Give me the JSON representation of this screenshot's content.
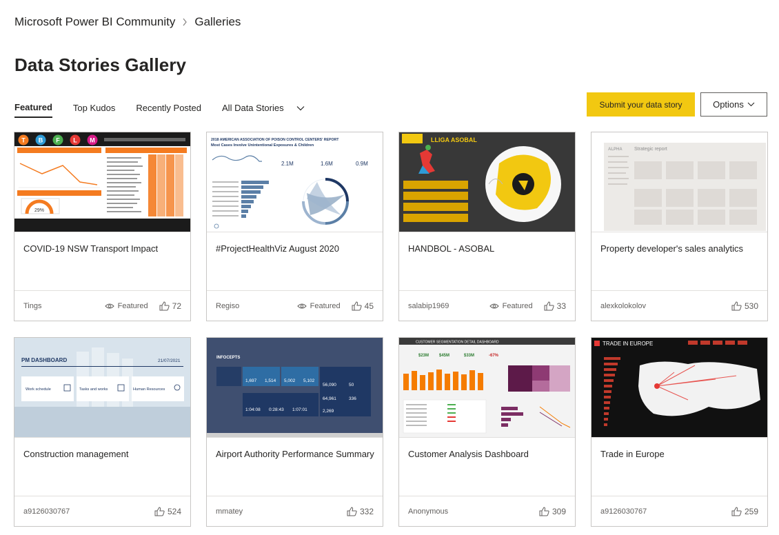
{
  "breadcrumb": {
    "home": "Microsoft Power BI Community",
    "current": "Galleries"
  },
  "page": {
    "title": "Data Stories Gallery"
  },
  "tabs": {
    "featured": "Featured",
    "top_kudos": "Top Kudos",
    "recently_posted": "Recently Posted",
    "all": "All Data Stories"
  },
  "actions": {
    "submit": "Submit your data story",
    "options": "Options"
  },
  "colors": {
    "accent": "#f2c811",
    "text": "#252423",
    "muted": "#605e5c",
    "border": "#c8c6c4"
  },
  "cards": [
    {
      "title": "COVID-19 NSW Transport Impact",
      "author": "Tings",
      "featured": "Featured",
      "kudos": "72",
      "thumb": {
        "line_letters": [
          "T",
          "B",
          "F",
          "L",
          "M"
        ],
        "pct_label": "29%"
      }
    },
    {
      "title": "#ProjectHealthViz August 2020",
      "author": "Regiso",
      "featured": "Featured",
      "kudos": "45",
      "thumb": {
        "heading1": "2018 AMERICAN ASSOCIATION OF POISON CONTROL CENTERS' REPORT",
        "heading2": "Most Cases Involve Unintentional Exposures & Children",
        "kpis": [
          "2.1M",
          "1.6M",
          "0.9M"
        ]
      }
    },
    {
      "title": "HANDBOL - ASOBAL",
      "author": "salabip1969",
      "featured": "Featured",
      "kudos": "33",
      "thumb": {
        "heading": "LLIGA ASOBAL"
      }
    },
    {
      "title": "Property developer's sales analytics",
      "author": "alexkolokolov",
      "featured": "",
      "kudos": "530",
      "thumb": {
        "brand": "ALPHA",
        "heading": "Strategic report"
      }
    },
    {
      "title": "Construction management",
      "author": "a9126030767",
      "featured": "",
      "kudos": "524",
      "thumb": {
        "heading": "PM DASHBOARD",
        "date": "21/07/2021",
        "buttons": [
          "Work schedule",
          "Tasks and works",
          "Human Resources"
        ]
      }
    },
    {
      "title": "Airport Authority Performance Summary",
      "author": "mmatey",
      "featured": "",
      "kudos": "332",
      "thumb": {
        "brand": "INFOCEPTS",
        "values": [
          "1,697",
          "1,514",
          "5,002",
          "5,102",
          "56,090",
          "50",
          "64,961",
          "336",
          "2,269",
          "1:04:08",
          "0:28:43",
          "1:07:01"
        ]
      }
    },
    {
      "title": "Customer Analysis Dashboard",
      "author": "Anonymous",
      "featured": "",
      "kudos": "309",
      "thumb": {
        "heading": "CUSTOMER SEGMENTATION DETAIL DASHBOARD",
        "kpis": [
          "$23M",
          "$45M",
          "$33M",
          "-67%"
        ]
      }
    },
    {
      "title": "Trade in Europe",
      "author": "a9126030767",
      "featured": "",
      "kudos": "259",
      "thumb": {
        "heading": "TRADE IN EUROPE"
      }
    }
  ]
}
